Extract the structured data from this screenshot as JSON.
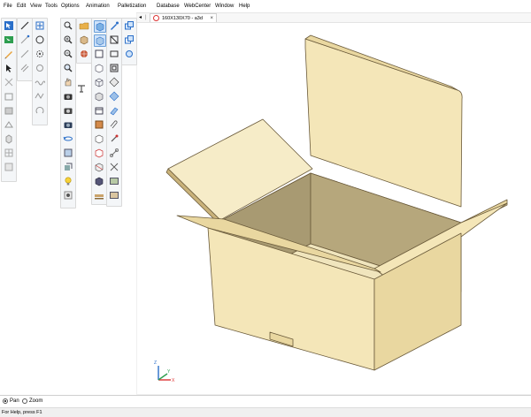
{
  "menu": [
    "File",
    "Edit",
    "View",
    "Tools",
    "Options",
    "Animation",
    "Palletization",
    "Database",
    "WebCenter",
    "Window",
    "Help"
  ],
  "tab": {
    "arrow": "◂",
    "label": "160X130X70 - a3d",
    "close": "×"
  },
  "modes": {
    "pan": "Pan",
    "zoom": "Zoom",
    "selected": "pan"
  },
  "status": "For Help, press F1",
  "axis": {
    "x": "X",
    "y": "Y",
    "z": "Z"
  },
  "colors": {
    "board": "#f4e6b8",
    "board_shade": "#e9d7a0",
    "inner_dark": "#a89a72",
    "inner_mid": "#c3b386",
    "edge": "#6a5a3a",
    "accent": "#2a6fc9"
  }
}
